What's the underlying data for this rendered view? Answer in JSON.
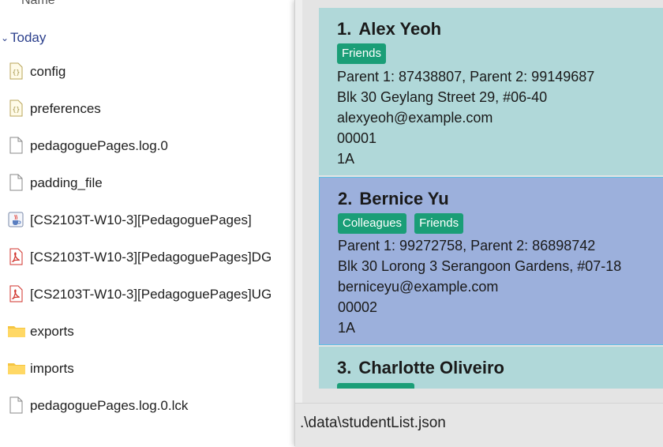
{
  "explorer": {
    "column_header": "Name",
    "group": {
      "label": "Today"
    },
    "files": [
      {
        "name": "config",
        "icon": "json-file-icon"
      },
      {
        "name": "preferences",
        "icon": "json-file-icon"
      },
      {
        "name": "pedagoguePages.log.0",
        "icon": "blank-file-icon"
      },
      {
        "name": "padding_file",
        "icon": "blank-file-icon"
      },
      {
        "name": "[CS2103T-W10-3][PedagoguePages]",
        "icon": "java-jar-icon"
      },
      {
        "name": "[CS2103T-W10-3][PedagoguePages]DG",
        "icon": "pdf-file-icon"
      },
      {
        "name": "[CS2103T-W10-3][PedagoguePages]UG",
        "icon": "pdf-file-icon"
      },
      {
        "name": "exports",
        "icon": "folder-icon"
      },
      {
        "name": "imports",
        "icon": "folder-icon"
      },
      {
        "name": "pedagoguePages.log.0.lck",
        "icon": "blank-file-icon"
      }
    ]
  },
  "app": {
    "persons": [
      {
        "index": "1.",
        "name": "Alex Yeoh",
        "tags": [
          "Friends"
        ],
        "parents": "Parent 1: 87438807, Parent 2: 99149687",
        "address": "Blk 30 Geylang Street 29, #06-40",
        "email": "alexyeoh@example.com",
        "student_id": "00001",
        "class": "1A"
      },
      {
        "index": "2.",
        "name": "Bernice Yu",
        "tags": [
          "Colleagues",
          "Friends"
        ],
        "parents": "Parent 1: 99272758, Parent 2: 86898742",
        "address": "Blk 30 Lorong 3 Serangoon Gardens, #07-18",
        "email": "berniceyu@example.com",
        "student_id": "00002",
        "class": "1A"
      },
      {
        "index": "3.",
        "name": "Charlotte Oliveiro"
      }
    ],
    "status_bar": {
      "file_path": ".\\data\\studentList.json"
    }
  },
  "colors": {
    "card_default": "#b0d8d9",
    "card_selected": "#9cb0dc",
    "tag_bg": "#1a9e77",
    "explorer_group_text": "#2b3f8c"
  }
}
